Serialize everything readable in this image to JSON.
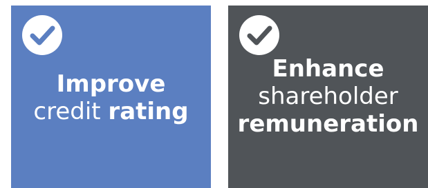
{
  "colors": {
    "left_tile_bg": "#5b7fc1",
    "right_tile_bg": "#505458",
    "check_circle": "#ffffff"
  },
  "icons": {
    "left": "check-circle-icon",
    "right": "check-circle-icon"
  },
  "left_tile": {
    "line1_bold": "Improve",
    "line2_light": "credit ",
    "line2_bold": "rating"
  },
  "right_tile": {
    "line1_bold": "Enhance",
    "line2_light": "shareholder",
    "line3_bold": "remuneration"
  }
}
